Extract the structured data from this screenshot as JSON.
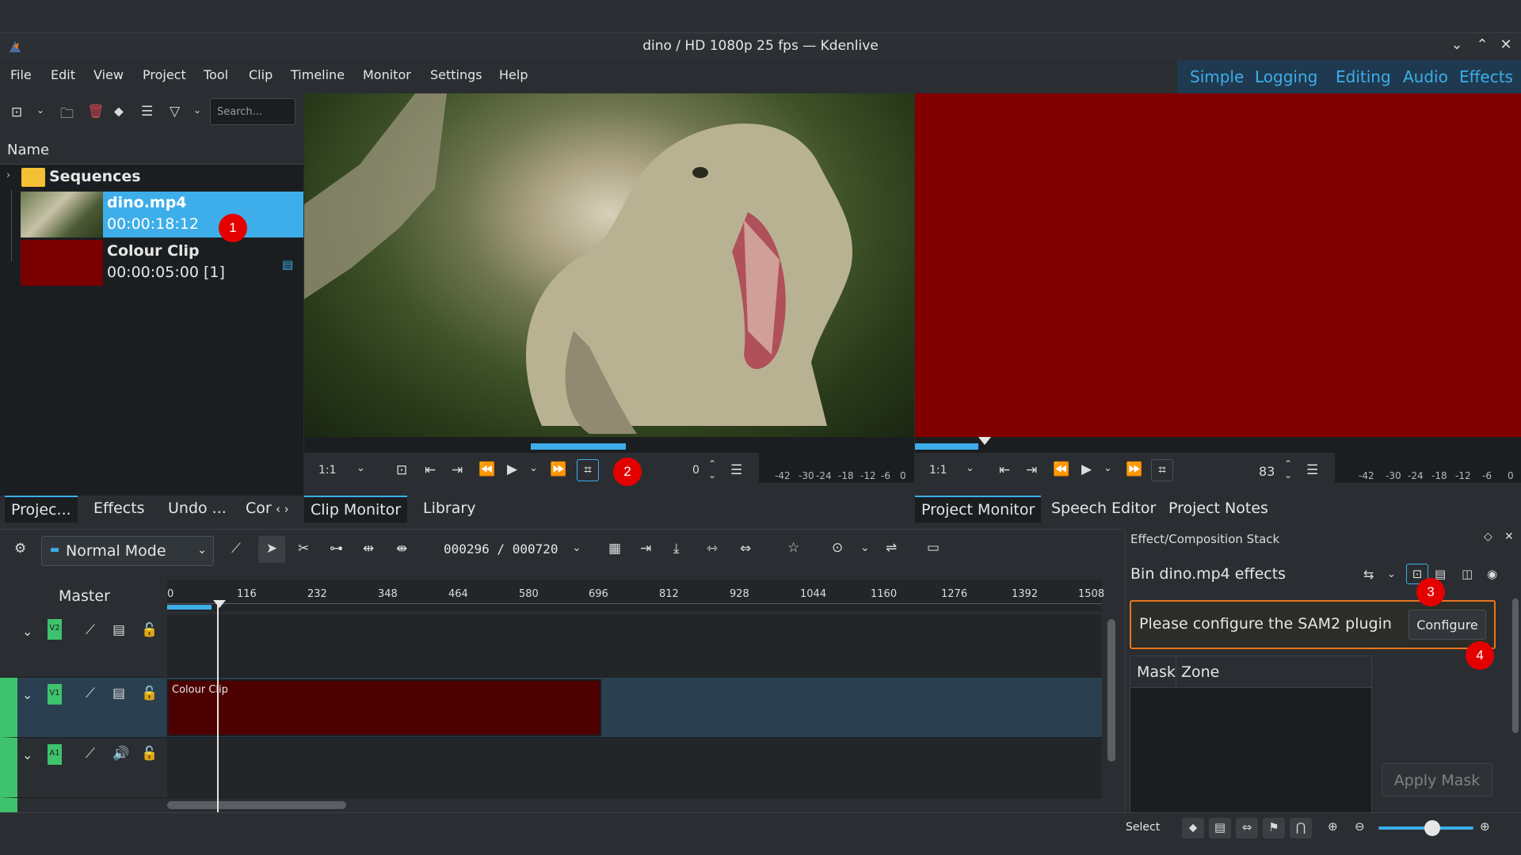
{
  "window": {
    "title": "dino / HD 1080p 25 fps — Kdenlive"
  },
  "menu": [
    "File",
    "Edit",
    "View",
    "Project",
    "Tool",
    "Clip",
    "Timeline",
    "Monitor",
    "Settings",
    "Help"
  ],
  "layouts": [
    "Simple",
    "Logging",
    "Editing",
    "Audio",
    "Effects"
  ],
  "bin": {
    "search_placeholder": "Search...",
    "column_header": "Name",
    "folder": "Sequences",
    "clips": [
      {
        "name": "dino.mp4",
        "duration": "00:00:18:12"
      },
      {
        "name": "Colour Clip",
        "duration": "00:00:05:00 [1]"
      }
    ],
    "tabs": [
      "Projec...",
      "Effects",
      "Undo ...",
      "Cor"
    ]
  },
  "clip_monitor": {
    "zoom": "1:1",
    "position": "0",
    "tabs": [
      "Clip Monitor",
      "Library"
    ],
    "meter_scale": [
      "-42",
      "-30",
      "-24",
      "-18",
      "-12",
      "-6",
      "0"
    ]
  },
  "project_monitor": {
    "zoom": "1:1",
    "position": "83",
    "tabs": [
      "Project Monitor",
      "Speech Editor",
      "Project Notes"
    ],
    "meter_scale": [
      "-42",
      "-30",
      "-24",
      "-18",
      "-12",
      "-6",
      "0"
    ]
  },
  "timeline": {
    "mode": "Normal Mode",
    "timecode": "000296 / 000720",
    "master_label": "Master",
    "ruler_ticks": [
      "0",
      "116",
      "232",
      "348",
      "464",
      "580",
      "696",
      "812",
      "928",
      "1044",
      "1160",
      "1276",
      "1392",
      "1508"
    ],
    "tracks": [
      {
        "tag": "V2"
      },
      {
        "tag": "V1"
      },
      {
        "tag": "A1"
      }
    ],
    "clip_label": "Colour Clip"
  },
  "effect_stack": {
    "title": "Effect/Composition Stack",
    "subtitle": "Bin dino.mp4 effects",
    "sam_message": "Please configure the SAM2 plugin",
    "configure_label": "Configure",
    "mask_headers": [
      "Mask",
      "Zone"
    ],
    "apply_mask_label": "Apply Mask"
  },
  "status": {
    "tool": "Select"
  },
  "annotations": [
    "1",
    "2",
    "3",
    "4"
  ],
  "colors": {
    "accent": "#3daee9",
    "selection": "#3daee9",
    "track_tag": "#3ec26d",
    "warning_border": "#e8741c",
    "badge": "#e50000",
    "colour_clip": "#800000"
  }
}
